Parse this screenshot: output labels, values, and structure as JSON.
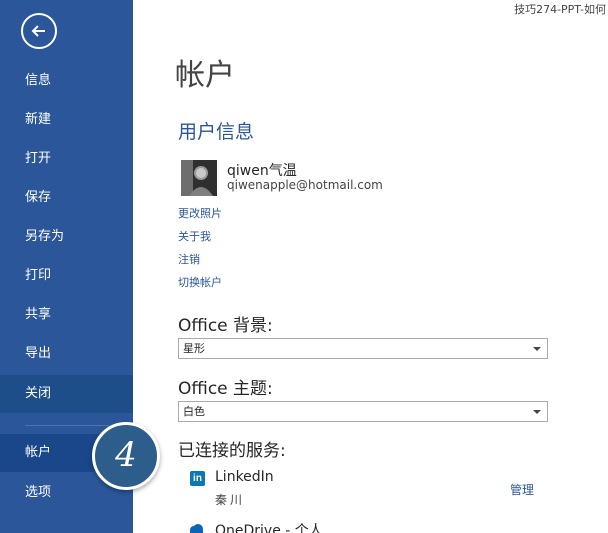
{
  "window": {
    "doc_title": "技巧274-PPT-如何"
  },
  "sidebar": {
    "back_icon": "back-arrow-icon",
    "items": [
      {
        "label": "信息"
      },
      {
        "label": "新建"
      },
      {
        "label": "打开"
      },
      {
        "label": "保存"
      },
      {
        "label": "另存为"
      },
      {
        "label": "打印"
      },
      {
        "label": "共享"
      },
      {
        "label": "导出"
      },
      {
        "label": "关闭"
      },
      {
        "label": "帐户"
      },
      {
        "label": "选项"
      }
    ],
    "selected": "帐户"
  },
  "callout": {
    "step": "4"
  },
  "main": {
    "page_title": "帐户",
    "user_section_title": "用户信息",
    "user": {
      "name": "qiwen气温",
      "email": "qiwenapple@hotmail.com"
    },
    "links": [
      "更改照片",
      "关于我",
      "注销",
      "切换帐户"
    ],
    "background": {
      "label": "Office 背景:",
      "value": "星形"
    },
    "theme": {
      "label": "Office 主题:",
      "value": "白色"
    },
    "services": {
      "title": "已连接的服务:",
      "items": [
        {
          "icon": "linkedin-icon",
          "icon_text": "in",
          "name": "LinkedIn",
          "user": "秦川",
          "action": "管理"
        },
        {
          "icon": "onedrive-icon",
          "name": "OneDrive - 个人"
        }
      ]
    }
  },
  "colors": {
    "sidebar": "#2b579a",
    "accent": "#2b579a",
    "linkedin": "#0b77b5"
  }
}
